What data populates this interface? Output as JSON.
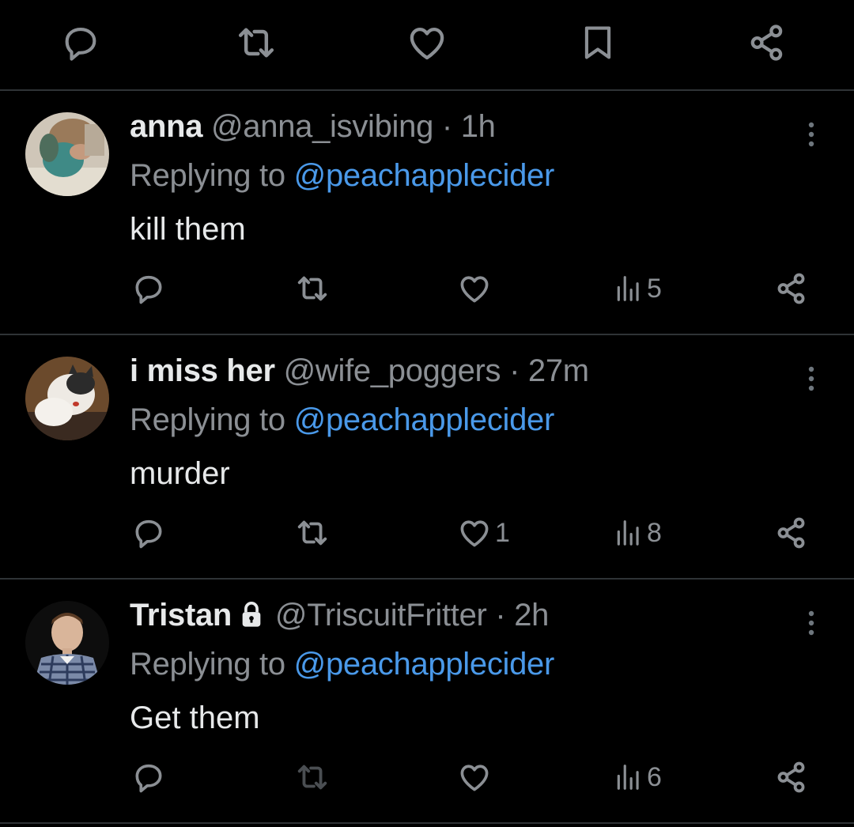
{
  "top_actions": [
    "reply-icon",
    "retweet-icon",
    "like-icon",
    "bookmark-icon",
    "share-icon"
  ],
  "replies": [
    {
      "display_name": "anna",
      "handle": "@anna_isvibing",
      "time": "· 1h",
      "locked": false,
      "replying_prefix": "Replying to",
      "replying_to": "@peachapplecider",
      "text": "kill them",
      "like_count": "",
      "view_count": "5"
    },
    {
      "display_name": "i miss her",
      "handle": "@wife_poggers",
      "time": "· 27m",
      "locked": false,
      "replying_prefix": "Replying to",
      "replying_to": "@peachapplecider",
      "text": "murder",
      "like_count": "1",
      "view_count": "8"
    },
    {
      "display_name": "Tristan",
      "handle": "@TriscuitFritter",
      "time": "· 2h",
      "locked": true,
      "replying_prefix": "Replying to",
      "replying_to": "@peachapplecider",
      "text": "Get them",
      "like_count": "",
      "view_count": "6"
    }
  ],
  "colors": {
    "background": "#000000",
    "text": "#e7e9ea",
    "muted": "#8b8f94",
    "link": "#4a99e9",
    "divider": "#2f3336"
  }
}
